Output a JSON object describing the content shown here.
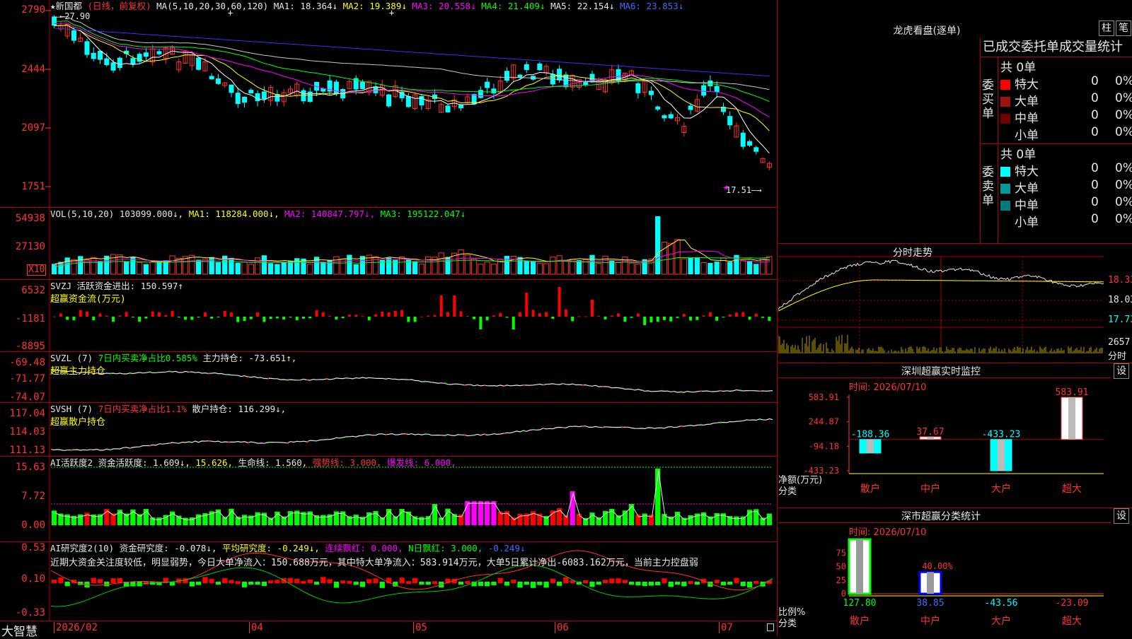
{
  "app": {
    "brand": "大智慧"
  },
  "kline": {
    "header": {
      "stock_name": "★新国都",
      "period": "(日线，前复权)",
      "ma_params": "MA(5,10,20,30,60,120)",
      "ma1": "MA1: 18.364↓",
      "ma2": "MA2: 19.389↓",
      "ma3": "MA3: 20.558↓",
      "ma4": "MA4: 21.409↓",
      "ma5": "MA5: 22.154↓",
      "ma6": "MA6: 23.853↓"
    },
    "y_ticks": [
      "2790",
      "2444",
      "2097",
      "1751"
    ],
    "high_label": "27.90",
    "low_label": "17.51",
    "colors": {
      "ma1": "#ffffff",
      "ma2": "#ffff00",
      "ma3": "#ff00ff",
      "ma4": "#00ff00",
      "ma5": "#c8c8c8",
      "ma6": "#3232ff",
      "up": "#ff3232",
      "down": "#00ffff"
    }
  },
  "volume": {
    "header": {
      "params": "VOL(5,10,20)",
      "vol": "103099.000↓,",
      "ma1": "MA1: 118284.000↓,",
      "ma2": "MA2: 140847.797↓,",
      "ma3": "MA3: 195122.047↓"
    },
    "y_ticks": [
      "54938",
      "27130"
    ],
    "unit": "X10"
  },
  "svzj": {
    "header": {
      "name": "SVZJ",
      "label": "活跃资金进出: 150.597↑",
      "subtitle": "超赢资金流(万元)"
    },
    "y_ticks": [
      "6532",
      "-1181",
      "-8895"
    ]
  },
  "svzl": {
    "header": {
      "name": "SVZL (7)",
      "label1": "7日内买卖净占比0.585%",
      "label2": "主力持仓: -73.651↑,",
      "subtitle": "超赢主力持仓"
    },
    "y_ticks": [
      "-69.48",
      "-71.77",
      "-74.07"
    ]
  },
  "svsh": {
    "header": {
      "name": "SVSH (7)",
      "label1": "7日内买卖净占比1.1%",
      "label2": "散户持仓: 116.299↓,",
      "subtitle": "超赢散户持仓"
    },
    "y_ticks": [
      "117.04",
      "114.03",
      "111.13"
    ]
  },
  "ai_active": {
    "header": {
      "name": "AI活跃度2",
      "label1": "资金活跃度: 1.609↓,",
      "label2": "15.626,",
      "label3": "生命线: 1.560,",
      "label4": "强势线: 3.000,",
      "label5": "爆发线: 6.000,"
    },
    "y_ticks": [
      "15.63",
      "7.72",
      "0.00"
    ]
  },
  "ai_research": {
    "header": {
      "name": "AI研究度2(10)",
      "label1": "资金研究度: -0.078↓,",
      "label2": "平均研究度: -0.249↓,",
      "label3": "连续飘红: 0.000,",
      "label4": "N日飘红: 3.000,",
      "label5": "-0.249↓"
    },
    "summary": "近期大资金关注度较低，明显弱势，今日大单净流入：150.688万元，其中特大单净流入：583.914万元，大单5日累计净出-6083.162万元，当前主力控盘弱",
    "y_ticks": [
      "0.53",
      "0.10",
      "-0.33"
    ]
  },
  "x_axis": {
    "labels": [
      "2026/02",
      "04",
      "05",
      "06",
      "07"
    ]
  },
  "dragon_tiger": {
    "title": "龙虎看盘(逐单)",
    "btn1": "柱",
    "btn2": "笔",
    "tabs": "已成交委托单成交量统计",
    "buy_label": "委买单",
    "sell_label": "委卖单",
    "buy_total": "共 0单",
    "sell_total": "共 0单",
    "buy_rows": [
      {
        "label": "特大",
        "value": "0",
        "pct": "0%",
        "color": "#ff0000"
      },
      {
        "label": "大单",
        "value": "0",
        "pct": "0%",
        "color": "#a01010"
      },
      {
        "label": "中单",
        "value": "0",
        "pct": "0%",
        "color": "#700000"
      },
      {
        "label": "小单",
        "value": "0",
        "pct": "0%",
        "color": ""
      }
    ],
    "sell_rows": [
      {
        "label": "特大",
        "value": "0",
        "pct": "0%",
        "color": "#00ffff"
      },
      {
        "label": "大单",
        "value": "0",
        "pct": "0%",
        "color": "#009a9a"
      },
      {
        "label": "中单",
        "value": "0",
        "pct": "0%",
        "color": "#007a7a"
      },
      {
        "label": "小单",
        "value": "0",
        "pct": "0%",
        "color": ""
      }
    ]
  },
  "intraday": {
    "title": "分时走势",
    "y_ticks": [
      "18.33",
      "18.03",
      "17.73"
    ],
    "vol_label": "2657",
    "vol_unit": "分时"
  },
  "sz_monitor": {
    "title": "深圳超赢实时监控",
    "btn": "设",
    "time": "时间: 2026/07/10",
    "axis_label": "净额(万元)",
    "axis_sub": "分类",
    "y_ticks": [
      "583.91",
      "244.87",
      "-94.18",
      "-433.23"
    ],
    "categories": [
      "散户",
      "中户",
      "大户",
      "超大"
    ],
    "values": [
      -188.36,
      37.67,
      -433.23,
      583.91
    ],
    "value_labels": [
      "-188.36",
      "37.67",
      "-433.23",
      "583.91"
    ]
  },
  "sz_class": {
    "title": "深市超赢分类统计",
    "btn": "设",
    "time": "时间: 2026/07/10",
    "axis_label": "比例%",
    "axis_sub": "分类",
    "y_ticks": [
      "75",
      "50",
      "25",
      "0"
    ],
    "categories": [
      "散户",
      "中户",
      "大户",
      "超大"
    ],
    "pct_values": [
      100,
      40,
      0,
      0
    ],
    "mid_label": "40.00%",
    "value_labels": [
      "127.80",
      "38.85",
      "-43.56",
      "-23.09"
    ]
  }
}
